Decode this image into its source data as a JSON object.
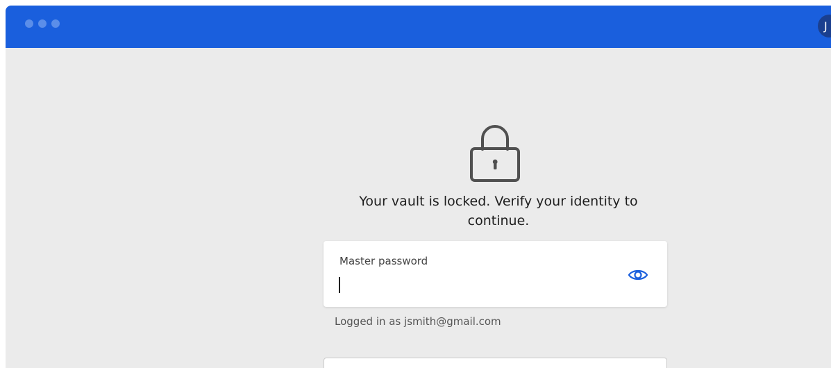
{
  "window": {
    "avatar_initial": "J"
  },
  "lock_screen": {
    "message": "Your vault is locked. Verify your identity to continue.",
    "password_field": {
      "label": "Master password",
      "value": ""
    },
    "logged_in_text": "Logged in as jsmith@gmail.com"
  },
  "icons": {
    "lock": "lock-icon",
    "toggle_visibility": "eye-icon"
  },
  "colors": {
    "titlebar": "#1a5fdd",
    "background": "#ebebeb",
    "accent": "#1a5fdd"
  }
}
